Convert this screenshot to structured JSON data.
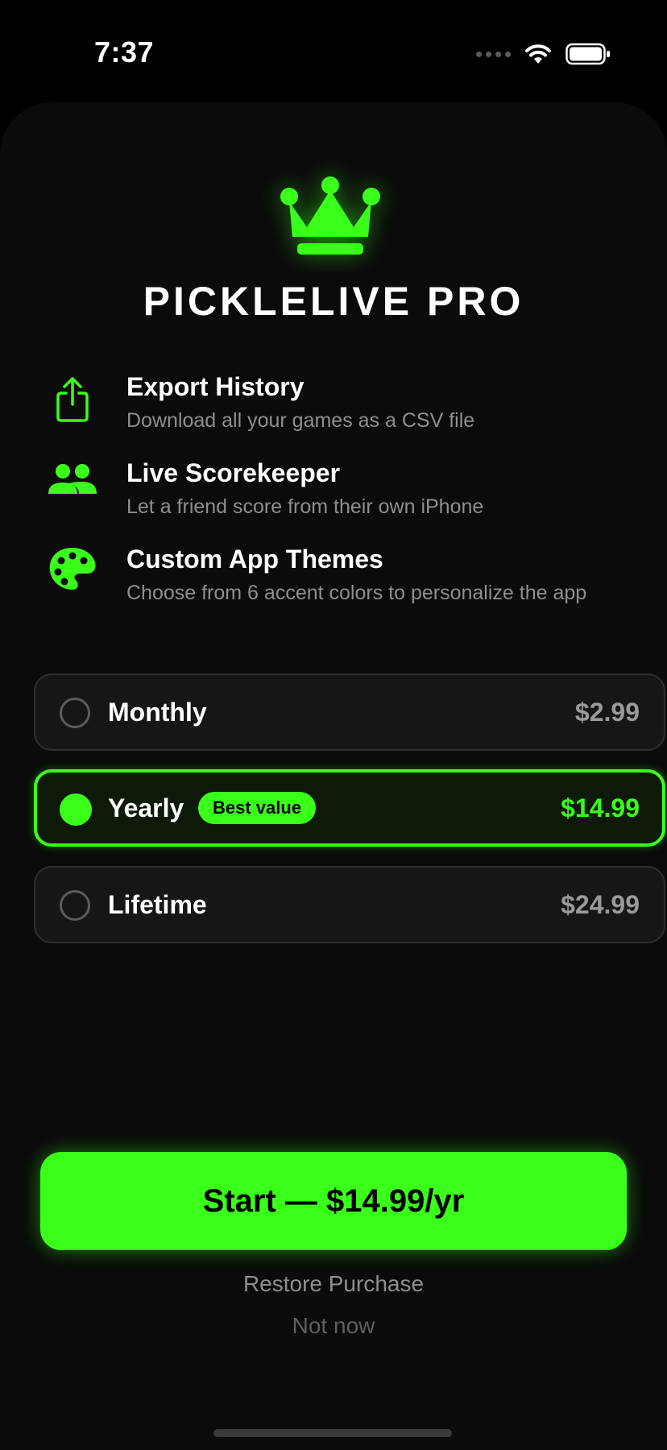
{
  "status_bar": {
    "time": "7:37",
    "icons": [
      "cellular-signal-icon",
      "wifi-icon",
      "battery-icon"
    ]
  },
  "header": {
    "icon": "crown-icon",
    "title": "PICKLELIVE PRO"
  },
  "features": [
    {
      "icon": "share-export-icon",
      "title": "Export History",
      "description": "Download all your games as a CSV file"
    },
    {
      "icon": "people-icon",
      "title": "Live Scorekeeper",
      "description": "Let a friend score from their own iPhone"
    },
    {
      "icon": "palette-icon",
      "title": "Custom App Themes",
      "description": "Choose from 6 accent colors to personalize the app"
    }
  ],
  "plans": [
    {
      "name": "Monthly",
      "price": "$2.99",
      "selected": false
    },
    {
      "name": "Yearly",
      "price": "$14.99",
      "selected": true,
      "badge": "Best value"
    },
    {
      "name": "Lifetime",
      "price": "$24.99",
      "selected": false
    }
  ],
  "cta": {
    "label": "Start — $14.99/yr"
  },
  "links": {
    "restore": "Restore Purchase",
    "not_now": "Not now"
  },
  "colors": {
    "accent": "#39ff1a",
    "background": "#000000",
    "sheet": "#0b0b0b",
    "secondary_text": "#8e8e93"
  }
}
